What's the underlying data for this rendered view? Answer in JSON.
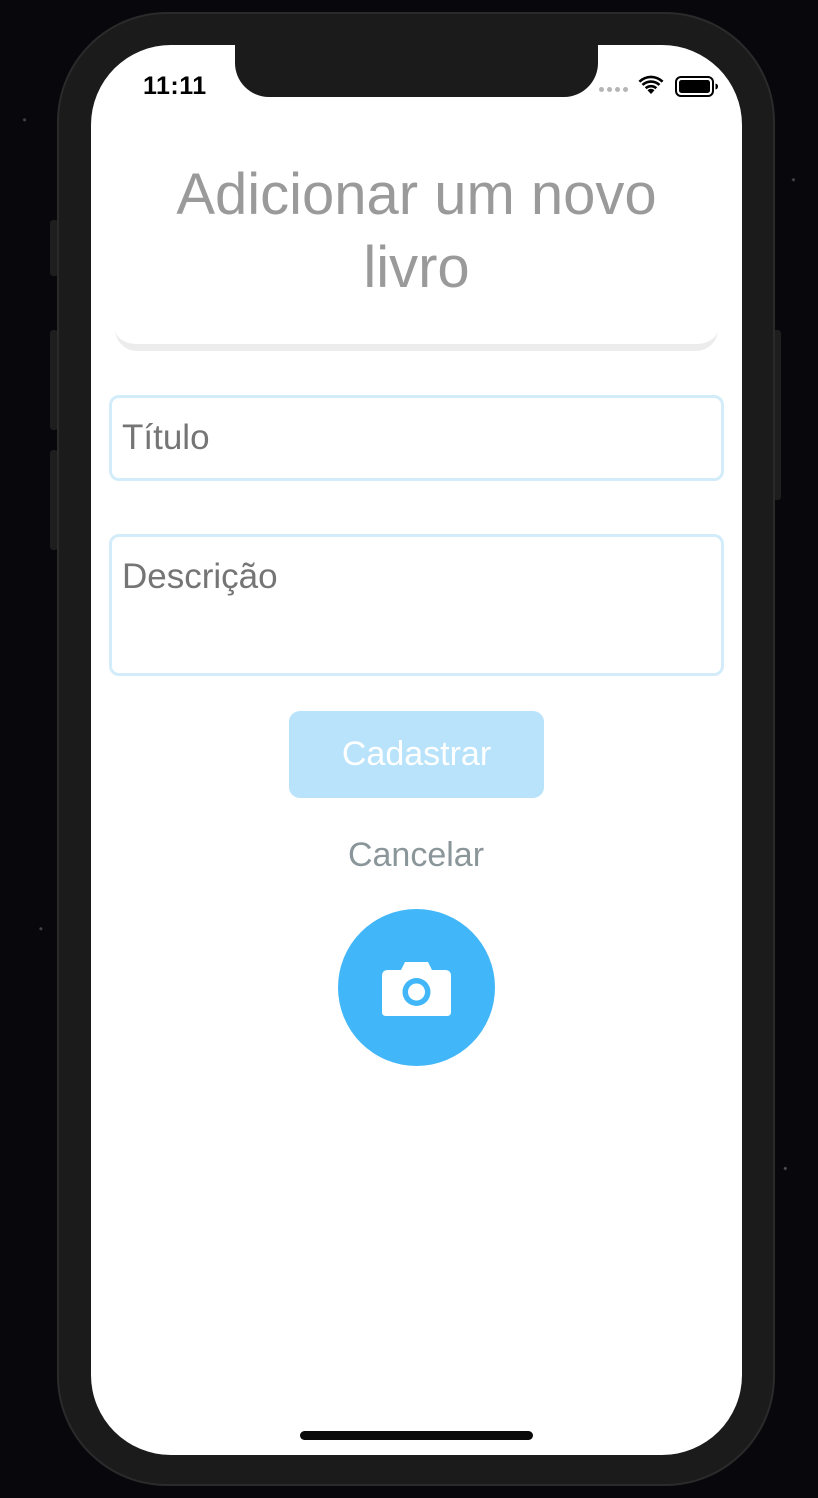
{
  "status_bar": {
    "time": "11:11",
    "signal_icon": "signal-dots-icon",
    "wifi_icon": "wifi-icon",
    "battery_icon": "battery-icon"
  },
  "page": {
    "title": "Adicionar um novo livro"
  },
  "form": {
    "title_field": {
      "placeholder": "Título",
      "value": ""
    },
    "description_field": {
      "placeholder": "Descrição",
      "value": ""
    },
    "submit_label": "Cadastrar",
    "cancel_label": "Cancelar",
    "camera_icon": "camera-icon"
  },
  "colors": {
    "accent": "#41b6f8",
    "button_disabled": "#b8e3fa",
    "field_border": "#d3ecfa",
    "title_text": "#9a9a9a",
    "cancel_text": "#8a9699"
  }
}
